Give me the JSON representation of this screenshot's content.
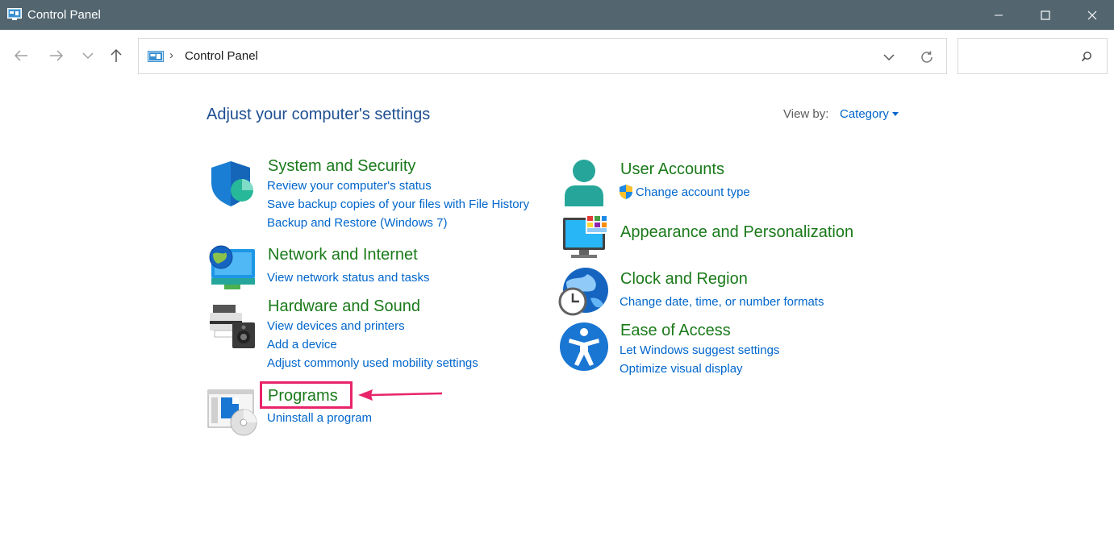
{
  "window": {
    "title": "Control Panel",
    "icon": "control-panel-icon"
  },
  "address": {
    "crumb": "Control Panel",
    "search_placeholder": ""
  },
  "header": {
    "title": "Adjust your computer's settings",
    "view_by_label": "View by:",
    "view_by_value": "Category"
  },
  "categories": {
    "system_security": {
      "title": "System and Security",
      "icon": "shield-icon",
      "links": [
        "Review your computer's status",
        "Save backup copies of your files with File History",
        "Backup and Restore (Windows 7)"
      ]
    },
    "network": {
      "title": "Network and Internet",
      "icon": "network-globe-icon",
      "links": [
        "View network status and tasks"
      ]
    },
    "hardware": {
      "title": "Hardware and Sound",
      "icon": "printer-speaker-icon",
      "links": [
        "View devices and printers",
        "Add a device",
        "Adjust commonly used mobility settings"
      ]
    },
    "programs": {
      "title": "Programs",
      "icon": "programs-disc-icon",
      "links": [
        "Uninstall a program"
      ]
    },
    "user_accounts": {
      "title": "User Accounts",
      "icon": "user-icon",
      "links": [
        "Change account type"
      ]
    },
    "appearance": {
      "title": "Appearance and Personalization",
      "icon": "monitor-palette-icon",
      "links": []
    },
    "clock": {
      "title": "Clock and Region",
      "icon": "globe-clock-icon",
      "links": [
        "Change date, time, or number formats"
      ]
    },
    "ease": {
      "title": "Ease of Access",
      "icon": "accessibility-icon",
      "links": [
        "Let Windows suggest settings",
        "Optimize visual display"
      ]
    }
  },
  "colors": {
    "titlebar": "#536670",
    "category_title": "#1a7a1a",
    "link": "#0066cc",
    "heading": "#1e4f91",
    "highlight": "#e8246a"
  }
}
